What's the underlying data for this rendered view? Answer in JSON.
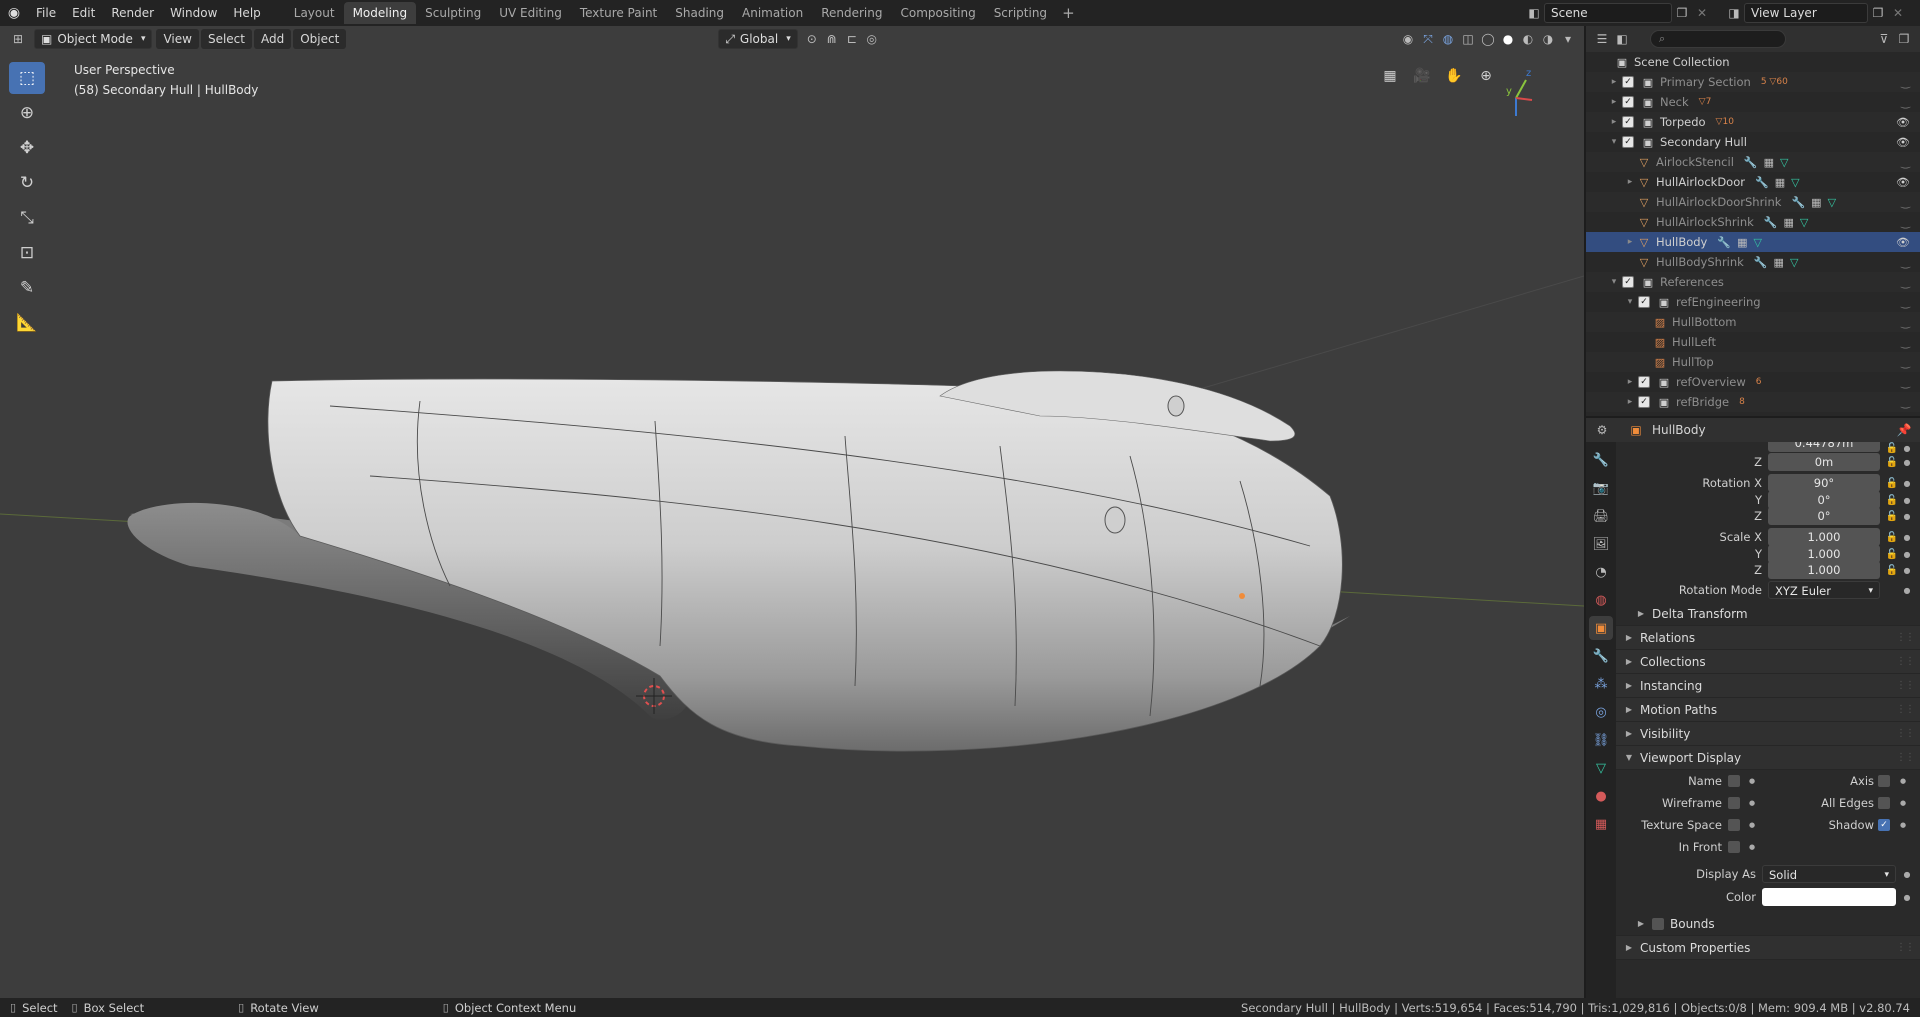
{
  "topbar": {
    "menus": [
      "File",
      "Edit",
      "Render",
      "Window",
      "Help"
    ],
    "workspaces": [
      "Layout",
      "Modeling",
      "Sculpting",
      "UV Editing",
      "Texture Paint",
      "Shading",
      "Animation",
      "Rendering",
      "Compositing",
      "Scripting"
    ],
    "active_workspace": "Modeling",
    "scene": "Scene",
    "view_layer": "View Layer"
  },
  "viewport": {
    "mode": "Object Mode",
    "menus": [
      "View",
      "Select",
      "Add",
      "Object"
    ],
    "orientation": "Global",
    "perspective_label": "User Perspective",
    "object_label": "(58) Secondary Hull | HullBody",
    "gizmo_axes": {
      "y": "y",
      "z": "z"
    }
  },
  "outliner": {
    "root": "Scene Collection",
    "rows": [
      {
        "label": "Primary Section",
        "indent": 0,
        "expand": "▸",
        "kind": "coll",
        "dim": true,
        "badges": "5 ▽60",
        "eye": false
      },
      {
        "label": "Neck",
        "indent": 0,
        "expand": "▸",
        "kind": "coll",
        "dim": true,
        "badges": "▽7",
        "eye": false
      },
      {
        "label": "Torpedo",
        "indent": 0,
        "expand": "▸",
        "kind": "coll",
        "dim": false,
        "badges": "▽10",
        "eye": true
      },
      {
        "label": "Secondary Hull",
        "indent": 0,
        "expand": "▾",
        "kind": "coll",
        "dim": false,
        "badges": "",
        "eye": true
      },
      {
        "label": "AirlockStencil",
        "indent": 1,
        "expand": "",
        "kind": "mesh",
        "dim": true,
        "badges": "",
        "eye": false
      },
      {
        "label": "HullAirlockDoor",
        "indent": 1,
        "expand": "▸",
        "kind": "mesh",
        "dim": false,
        "badges": "",
        "eye": true
      },
      {
        "label": "HullAirlockDoorShrink",
        "indent": 1,
        "expand": "",
        "kind": "mesh",
        "dim": true,
        "badges": "",
        "eye": false
      },
      {
        "label": "HullAirlockShrink",
        "indent": 1,
        "expand": "",
        "kind": "mesh",
        "dim": true,
        "badges": "",
        "eye": false
      },
      {
        "label": "HullBody",
        "indent": 1,
        "expand": "▸",
        "kind": "mesh",
        "dim": false,
        "badges": "",
        "eye": true,
        "selected": true
      },
      {
        "label": "HullBodyShrink",
        "indent": 1,
        "expand": "",
        "kind": "mesh",
        "dim": true,
        "badges": "",
        "eye": false
      },
      {
        "label": "References",
        "indent": 0,
        "expand": "▾",
        "kind": "coll",
        "dim": true,
        "badges": "",
        "eye": false
      },
      {
        "label": "refEngineering",
        "indent": 1,
        "expand": "▾",
        "kind": "coll",
        "dim": true,
        "badges": "",
        "eye": false
      },
      {
        "label": "HullBottom",
        "indent": 2,
        "expand": "",
        "kind": "img",
        "dim": true,
        "badges": "",
        "eye": false
      },
      {
        "label": "HullLeft",
        "indent": 2,
        "expand": "",
        "kind": "img",
        "dim": true,
        "badges": "",
        "eye": false
      },
      {
        "label": "HullTop",
        "indent": 2,
        "expand": "",
        "kind": "img",
        "dim": true,
        "badges": "",
        "eye": false
      },
      {
        "label": "refOverview",
        "indent": 1,
        "expand": "▸",
        "kind": "coll",
        "dim": true,
        "badges": "6",
        "eye": false
      },
      {
        "label": "refBridge",
        "indent": 1,
        "expand": "▸",
        "kind": "coll",
        "dim": true,
        "badges": "8",
        "eye": false
      }
    ]
  },
  "properties": {
    "object_name": "HullBody",
    "fields": [
      {
        "label": "Z",
        "value": "0m"
      },
      {
        "label": "Rotation X",
        "value": "90°"
      },
      {
        "label": "Y",
        "value": "0°"
      },
      {
        "label": "Z",
        "value": "0°"
      },
      {
        "label": "Scale X",
        "value": "1.000"
      },
      {
        "label": "Y",
        "value": "1.000"
      },
      {
        "label": "Z",
        "value": "1.000"
      }
    ],
    "partial_top_value": "0.44787m",
    "rotation_mode_label": "Rotation Mode",
    "rotation_mode": "XYZ Euler",
    "delta_transform": "Delta Transform",
    "panels": [
      "Relations",
      "Collections",
      "Instancing",
      "Motion Paths",
      "Visibility"
    ],
    "viewport_display": {
      "title": "Viewport Display",
      "name_label": "Name",
      "axis_label": "Axis",
      "wireframe_label": "Wireframe",
      "all_edges_label": "All Edges",
      "texture_space_label": "Texture Space",
      "shadow_label": "Shadow",
      "in_front_label": "In Front",
      "display_as_label": "Display As",
      "display_as": "Solid",
      "color_label": "Color",
      "shadow_checked": true
    },
    "bounds": "Bounds",
    "custom_properties": "Custom Properties"
  },
  "statusbar": {
    "select": "Select",
    "box_select": "Box Select",
    "rotate_view": "Rotate View",
    "context_menu": "Object Context Menu",
    "stats": "Secondary Hull | HullBody | Verts:519,654 | Faces:514,790 | Tris:1,029,816 | Objects:0/8 | Mem: 909.4 MB | v2.80.74"
  }
}
